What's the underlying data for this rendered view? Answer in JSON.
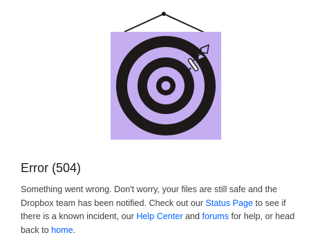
{
  "illustration": {
    "icon": "target-with-dart-icon",
    "frame_color": "#c4aef1",
    "ring_color": "#1e1919"
  },
  "error": {
    "title": "Error (504)",
    "message_part1": "Something went wrong. Don't worry, your files are still safe and the Dropbox team has been notified. Check out our ",
    "status_page_link": "Status Page",
    "message_part2": " to see if there is a known incident, our ",
    "help_center_link": "Help Center",
    "message_part3": " and ",
    "forums_link": "forums",
    "message_part4": " for help, or head back to ",
    "home_link": "home",
    "message_part5": "."
  },
  "colors": {
    "link": "#0061fe",
    "text": "#3d3d3d",
    "title": "#1e1919"
  }
}
